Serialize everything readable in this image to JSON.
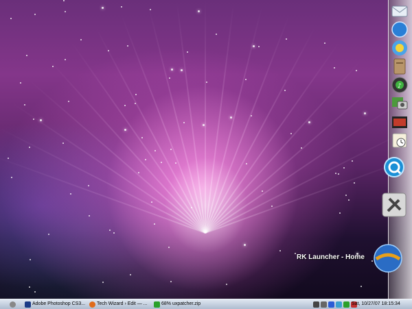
{
  "launcher": {
    "label": "RK Launcher - Home"
  },
  "dock": {
    "icons": [
      "mail-icon",
      "safari-icon",
      "ichat-icon",
      "address-book-icon",
      "itunes-icon",
      "iphoto-icon",
      "imovie-icon",
      "ical-icon",
      "quicktime-icon",
      "system-tools-icon",
      "launcher-home-icon"
    ]
  },
  "taskbar": {
    "start_icon": "apple-icon",
    "items": [
      {
        "label": "Adobe Photoshop CS3...",
        "icon": "photoshop-icon"
      },
      {
        "label": "Tech Wizard › Edit — ...",
        "icon": "firefox-icon"
      },
      {
        "label": "68% uxpatcher.zip",
        "icon": "download-icon"
      }
    ],
    "tray_icons": [
      "monitor-icon",
      "speaker-icon",
      "bluetooth-icon",
      "network-icon",
      "play-icon",
      "security-icon"
    ],
    "clock": "Sat, 10/27/07 18:15:34"
  },
  "colors": {
    "accent": "#c04ec8",
    "taskbar": "#c6d2e2"
  }
}
